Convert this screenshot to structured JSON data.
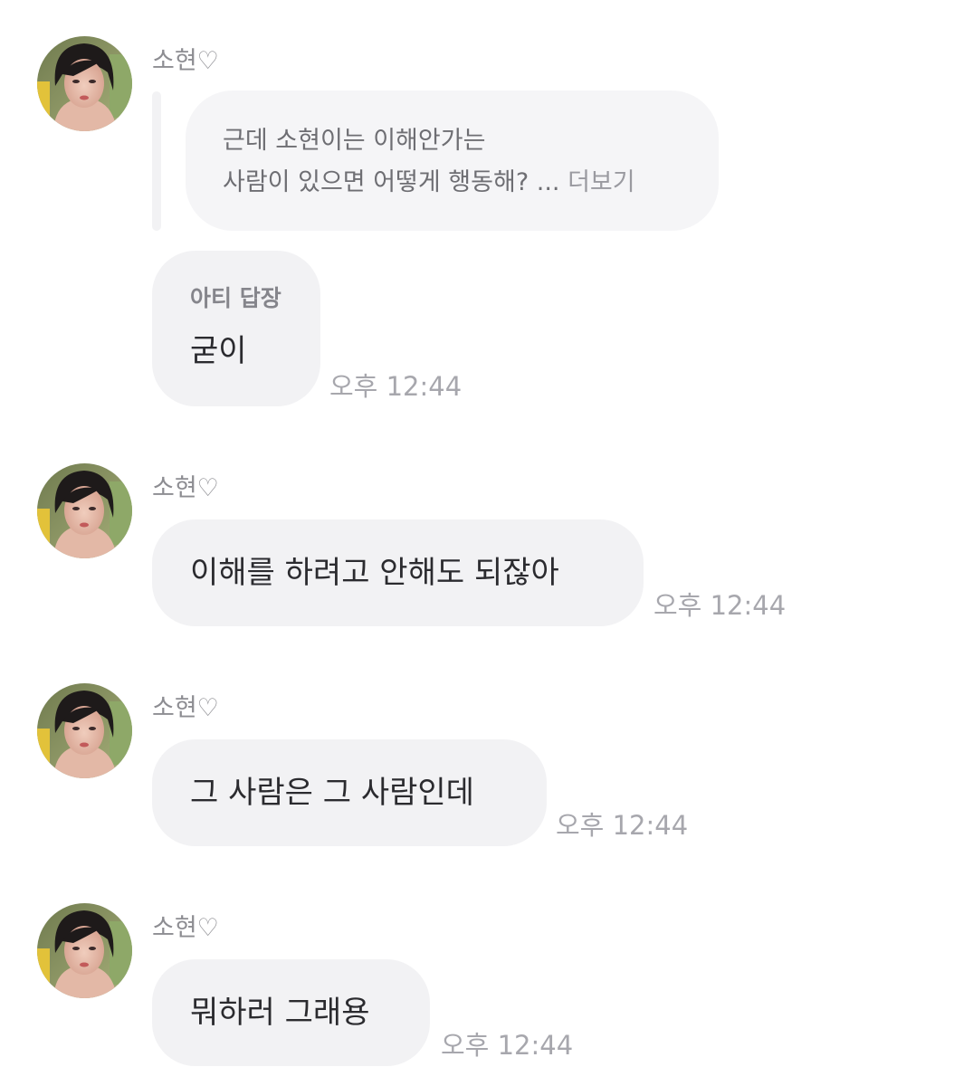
{
  "chat": {
    "messages": [
      {
        "sender": "소현♡",
        "quote": {
          "line1": "근데 소현이는 이해안가는",
          "line2": "사람이 있으면 어떻게 행동해? ...",
          "more": "더보기"
        },
        "reply_label": "아티 답장",
        "text": "굳이",
        "time": "오후 12:44"
      },
      {
        "sender": "소현♡",
        "text": "이해를 하려고 안해도 되잖아",
        "time": "오후 12:44"
      },
      {
        "sender": "소현♡",
        "text": "그 사람은 그 사람인데",
        "time": "오후 12:44"
      },
      {
        "sender": "소현♡",
        "text": "뭐하러 그래용",
        "time": "오후 12:44"
      }
    ]
  },
  "colors": {
    "bubble": "#f2f2f4",
    "sender": "#8d8d92",
    "time": "#a7a7ad",
    "text": "#2b2b2f"
  }
}
